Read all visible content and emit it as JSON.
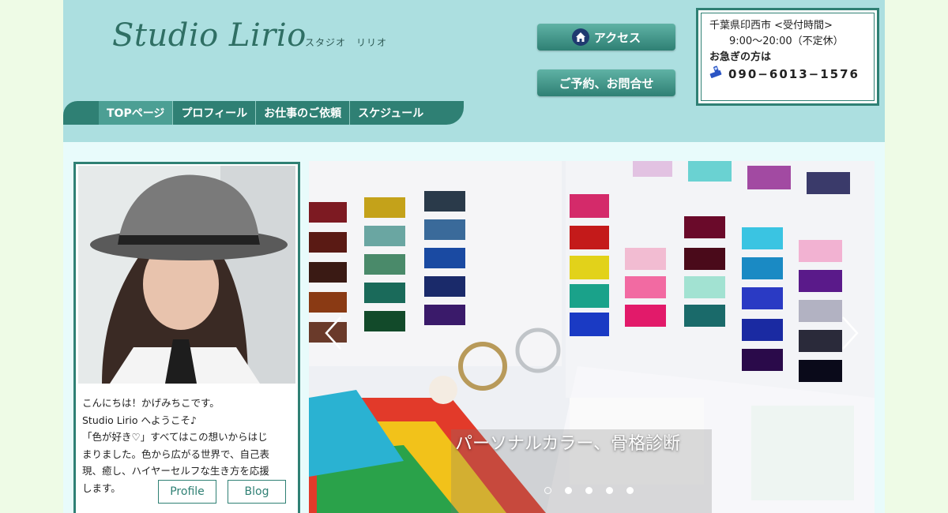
{
  "header": {
    "logo": "Studio Lirio",
    "logo_kana": "スタジオ　リリオ",
    "access_label": "アクセス",
    "reserve_label": "ご予約、お問合せ"
  },
  "info": {
    "line1": "千葉県印西市 <受付時間>",
    "hours": "9:00～20:00（不定休）",
    "urgent": "お急ぎの方は",
    "phone": "090−6013−1576"
  },
  "nav": {
    "items": [
      "TOPページ",
      "プロフィール",
      "お仕事のご依頼",
      "スケジュール"
    ]
  },
  "profile": {
    "lines": [
      "こんにちは！かげみちこです。",
      "Studio Lirio へようこそ♪",
      "「色が好き♡」すべてはこの想いからはじ",
      "まりました。色から広がる世界で、自己表",
      "現、癒し、ハイヤーセルフな生き方を応援",
      "します。"
    ],
    "profile_btn": "Profile",
    "blog_btn": "Blog"
  },
  "slider": {
    "caption": "パーソナルカラー、骨格診断",
    "slide_count": 5,
    "active_index": 0
  },
  "icons": {
    "home": "home-icon",
    "phone": "mobile-phone-icon",
    "prev": "chevron-left-icon",
    "next": "chevron-right-icon"
  },
  "colors": {
    "accent": "#2f8074",
    "header_bg": "#acdfe0"
  }
}
